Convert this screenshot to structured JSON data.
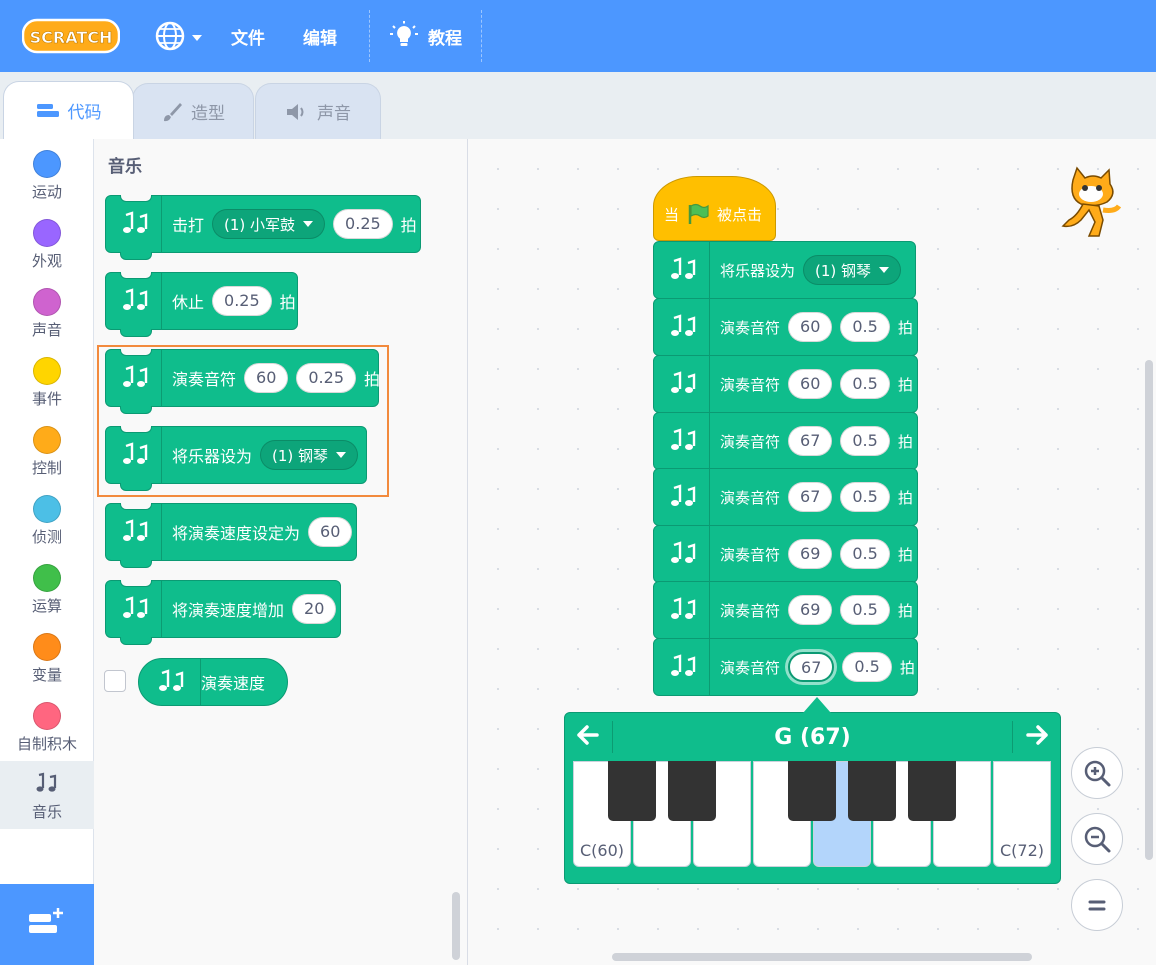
{
  "menubar": {
    "logo_text": "SCRATCH",
    "file": "文件",
    "edit": "编辑",
    "tutorials": "教程"
  },
  "tabs": {
    "code": "代码",
    "costumes": "造型",
    "sounds": "声音"
  },
  "categories": [
    {
      "label": "运动",
      "color": "#4c97ff"
    },
    {
      "label": "外观",
      "color": "#9966ff"
    },
    {
      "label": "声音",
      "color": "#cf63cf"
    },
    {
      "label": "事件",
      "color": "#ffd500"
    },
    {
      "label": "控制",
      "color": "#ffab19"
    },
    {
      "label": "侦测",
      "color": "#4cbfe6"
    },
    {
      "label": "运算",
      "color": "#40bf4a"
    },
    {
      "label": "变量",
      "color": "#ff8c1a"
    },
    {
      "label": "自制积木",
      "color": "#ff6680"
    },
    {
      "label": "音乐",
      "color": "music-notes-icon"
    }
  ],
  "palette": {
    "title": "音乐",
    "drum": {
      "label": "击打",
      "drum_value": "(1) 小军鼓",
      "beats": "0.25",
      "suffix": "拍"
    },
    "rest": {
      "label": "休止",
      "beats": "0.25",
      "suffix": "拍"
    },
    "play_note": {
      "label": "演奏音符",
      "note": "60",
      "beats": "0.25",
      "suffix": "拍"
    },
    "set_instrument": {
      "label": "将乐器设为",
      "instrument": "(1) 钢琴"
    },
    "set_tempo": {
      "label": "将演奏速度设定为",
      "tempo": "60"
    },
    "change_tempo": {
      "label": "将演奏速度增加",
      "delta": "20"
    },
    "tempo_reporter": {
      "label": "演奏速度"
    }
  },
  "script": {
    "hat": {
      "when": "当",
      "clicked": "被点击"
    },
    "set_instrument": {
      "label": "将乐器设为",
      "instrument": "(1) 钢琴"
    },
    "notes": [
      {
        "label": "演奏音符",
        "note": "60",
        "beats": "0.5",
        "suffix": "拍"
      },
      {
        "label": "演奏音符",
        "note": "60",
        "beats": "0.5",
        "suffix": "拍"
      },
      {
        "label": "演奏音符",
        "note": "67",
        "beats": "0.5",
        "suffix": "拍"
      },
      {
        "label": "演奏音符",
        "note": "67",
        "beats": "0.5",
        "suffix": "拍"
      },
      {
        "label": "演奏音符",
        "note": "69",
        "beats": "0.5",
        "suffix": "拍"
      },
      {
        "label": "演奏音符",
        "note": "69",
        "beats": "0.5",
        "suffix": "拍"
      },
      {
        "label": "演奏音符",
        "note": "67",
        "beats": "0.5",
        "suffix": "拍"
      }
    ]
  },
  "piano": {
    "selected_note": "G (67)",
    "low_label": "C(60)",
    "high_label": "C(72)"
  },
  "colors": {
    "menubar": "#4c97ff",
    "music": "#0fbd8c",
    "events": "#ffbf00",
    "highlight": "#f28a3d",
    "selected_key": "#b3d5fb"
  }
}
